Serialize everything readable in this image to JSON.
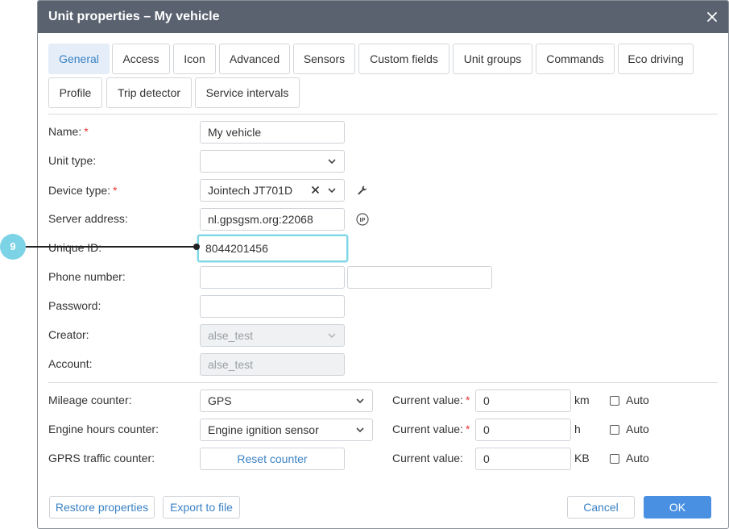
{
  "dialog": {
    "title": "Unit properties – My vehicle"
  },
  "tabs": [
    {
      "label": "General",
      "active": true
    },
    {
      "label": "Access"
    },
    {
      "label": "Icon"
    },
    {
      "label": "Advanced"
    },
    {
      "label": "Sensors"
    },
    {
      "label": "Custom fields"
    },
    {
      "label": "Unit groups"
    },
    {
      "label": "Commands"
    },
    {
      "label": "Eco driving"
    },
    {
      "label": "Profile"
    },
    {
      "label": "Trip detector"
    },
    {
      "label": "Service intervals"
    }
  ],
  "form": {
    "name": {
      "label": "Name:",
      "required": "*",
      "value": "My vehicle"
    },
    "unit_type": {
      "label": "Unit type:",
      "value": ""
    },
    "device_type": {
      "label": "Device type:",
      "required": "*",
      "value": "Jointech JT701D"
    },
    "server_address": {
      "label": "Server address:",
      "value": "nl.gpsgsm.org:22068"
    },
    "unique_id": {
      "label": "Unique ID:",
      "value": "8044201456"
    },
    "phone_number": {
      "label": "Phone number:",
      "value": "",
      "value2": ""
    },
    "password": {
      "label": "Password:",
      "value": ""
    },
    "creator": {
      "label": "Creator:",
      "value": "alse_test"
    },
    "account": {
      "label": "Account:",
      "value": "alse_test"
    }
  },
  "counters": {
    "mileage": {
      "label": "Mileage counter:",
      "value": "GPS",
      "current_label": "Current value:",
      "required": "*",
      "current_value": "0",
      "unit": "km",
      "auto_label": "Auto",
      "auto_checked": false
    },
    "engine_hours": {
      "label": "Engine hours counter:",
      "value": "Engine ignition sensor",
      "current_label": "Current value:",
      "required": "*",
      "current_value": "0",
      "unit": "h",
      "auto_label": "Auto",
      "auto_checked": false
    },
    "gprs": {
      "label": "GPRS traffic counter:",
      "button": "Reset counter",
      "current_label": "Current value:",
      "current_value": "0",
      "unit": "KB",
      "auto_label": "Auto",
      "auto_checked": false
    }
  },
  "footer": {
    "restore": "Restore properties",
    "export": "Export to file",
    "cancel": "Cancel",
    "ok": "OK"
  },
  "callout": {
    "number": "9"
  },
  "colors": {
    "titlebar": "#5a6270",
    "accent": "#4a90e2",
    "callout": "#7dd3e6",
    "required": "#e53935"
  }
}
